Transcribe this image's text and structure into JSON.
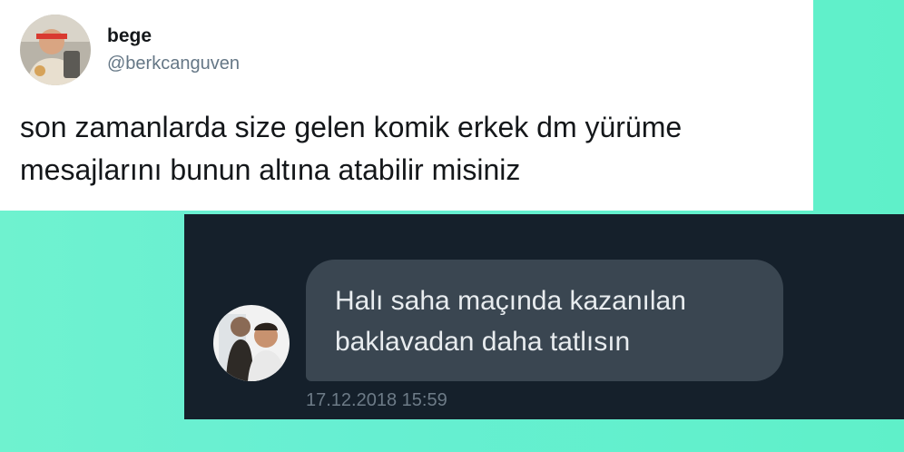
{
  "tweet": {
    "name": "bege",
    "handle": "@berkcanguven",
    "text": "son zamanlarda size gelen komik erkek dm yürüme mesajlarını bunun altına atabilir misiniz",
    "avatar_icon": "profile-photo-icon"
  },
  "dm": {
    "message": "Halı saha maçında kazanılan baklavadan daha tatlısın",
    "timestamp": "17.12.2018 15:59",
    "avatar_icon": "profile-photo-icon"
  },
  "colors": {
    "background": "#67efd2",
    "tweet_card": "#ffffff",
    "dm_panel": "#15202b",
    "dm_bubble": "#3a4651",
    "handle": "#657786",
    "timestamp": "#6d7b87"
  }
}
